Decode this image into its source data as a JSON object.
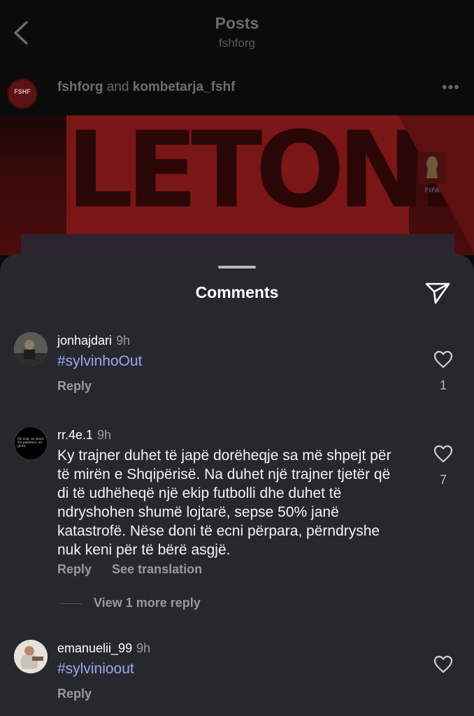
{
  "header": {
    "title": "Posts",
    "subtitle": "fshforg"
  },
  "post": {
    "avatar_text": "FSHF",
    "author": "fshforg",
    "connector": "and",
    "coauthor": "kombetarja_fshf",
    "more_icon": "more-horizontal-icon",
    "banner_text": "LETONI",
    "badge_text": "FIFA"
  },
  "sheet": {
    "title": "Comments",
    "send_icon": "send-icon"
  },
  "comments": [
    {
      "username": "jonhajdari",
      "time": "9h",
      "text": "#sylvinhoOut",
      "reply": "Reply",
      "likes": "1"
    },
    {
      "username": "rr.4e.1",
      "time": "9h",
      "avatar_text": "No risk, no story. No patience, no glory.",
      "text": "Ky trajner duhet të japë dorëheqje sa më shpejt për të mirën e Shqipërisë. Na duhet një trajner tjetër që di të udhëheqë një ekip futbolli dhe duhet të ndryshohen shumë lojtarë, sepse 50% janë katastrofë. Nëse doni të ecni përpara, përndryshe nuk keni për të bërë asgjë.",
      "reply": "Reply",
      "see_translation": "See translation",
      "likes": "7",
      "view_more": "View 1 more reply"
    },
    {
      "username": "emanuelii_99",
      "time": "9h",
      "text": "#sylvinioout",
      "reply": "Reply"
    }
  ],
  "colors": {
    "sheet_bg": "#26282d",
    "hashtag": "#9aa8f5",
    "muted": "#9a9a9a"
  }
}
